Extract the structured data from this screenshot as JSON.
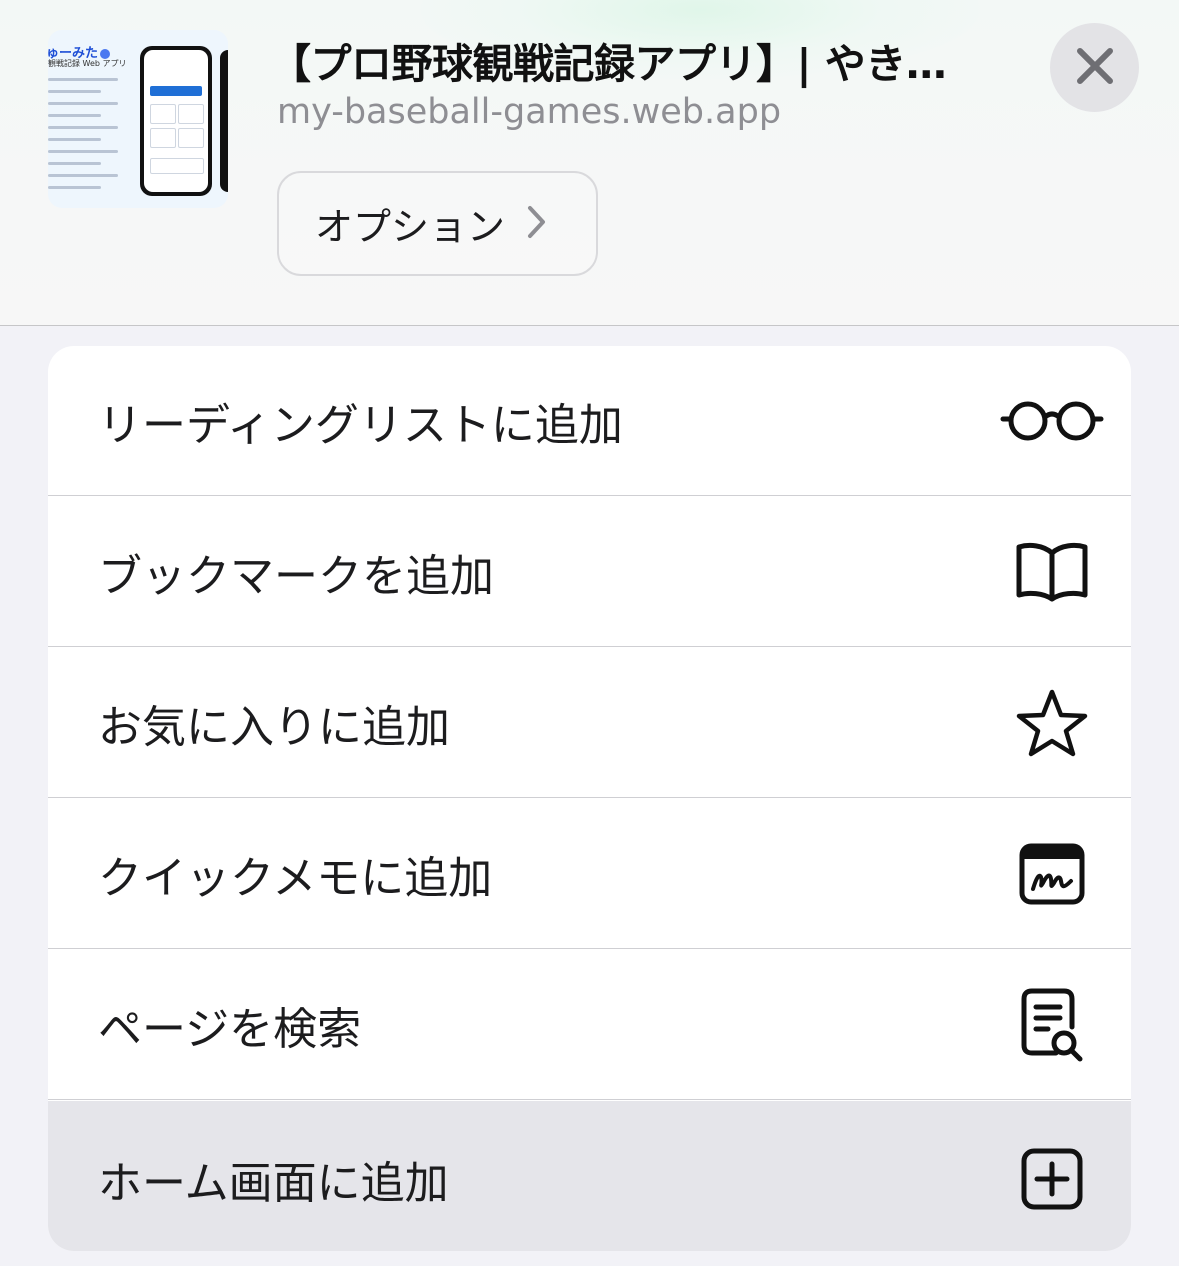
{
  "header": {
    "title": "【プロ野球観戦記録アプリ】| やき…",
    "url": "my-baseball-games.web.app",
    "options_label": "オプション",
    "thumbnail": {
      "brand": "ゅーみた",
      "subtitle": "観戦記録 Web アプリ"
    }
  },
  "menu": {
    "items": [
      {
        "label": "リーディングリストに追加",
        "icon": "glasses-icon"
      },
      {
        "label": "ブックマークを追加",
        "icon": "book-icon"
      },
      {
        "label": "お気に入りに追加",
        "icon": "star-icon"
      },
      {
        "label": "クイックメモに追加",
        "icon": "quick-note-icon"
      },
      {
        "label": "ページを検索",
        "icon": "find-in-page-icon"
      },
      {
        "label": "ホーム画面に追加",
        "icon": "add-square-icon"
      }
    ]
  },
  "colors": {
    "sheet_background": "#f2f2f7",
    "menu_background": "#ffffff",
    "highlight": "#e5e5ea",
    "secondary_text": "#8e8e93"
  }
}
